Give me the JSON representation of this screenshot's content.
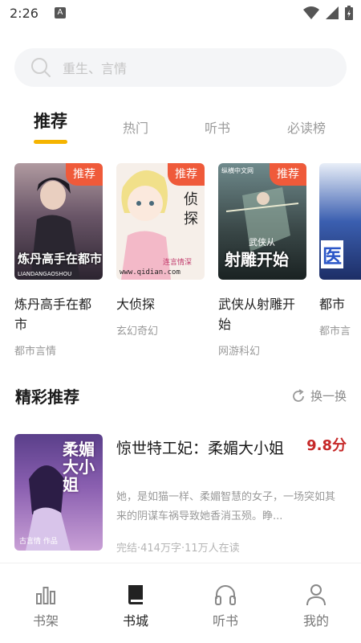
{
  "status_bar": {
    "time": "2:26",
    "notif_letter": "A"
  },
  "search": {
    "placeholder": "重生、言情"
  },
  "tabs": [
    {
      "label": "推荐"
    },
    {
      "label": "热门"
    },
    {
      "label": "听书"
    },
    {
      "label": "必读榜"
    }
  ],
  "books": [
    {
      "badge": "推荐",
      "title": "炼丹高手在都市",
      "genre": "都市言情",
      "cover_text": "炼丹高手在都市",
      "cover_sub": "LIANDANGAOSHOU"
    },
    {
      "badge": "推荐",
      "title": "大侦探",
      "genre": "玄幻奇幻",
      "cover_text": "侦探",
      "cover_sub": "www.qidian.com",
      "cover_small": "连言情深"
    },
    {
      "badge": "推荐",
      "title": "武侠从射雕开始",
      "genre": "网游科幻",
      "cover_text": "射雕开始",
      "cover_top": "武侠从",
      "cover_brand": "纵横中文网"
    },
    {
      "badge": "",
      "title": "都市",
      "genre": "都市言",
      "cover_text": "医"
    }
  ],
  "section": {
    "title": "精彩推荐",
    "refresh_label": "换一换"
  },
  "featured": {
    "title": "惊世特工妃：柔媚大小姐",
    "score": "9.8分",
    "description": "她，是如猫一样、柔媚智慧的女子，一场突如其来的阴谋车祸导致她香消玉殒。睁...",
    "stats": "完结·414万字·11万人在读",
    "cover_text": "柔媚大小姐",
    "cover_author": "古言情 作品"
  },
  "bottom_nav": [
    {
      "label": "书架",
      "icon": "bar-chart-icon"
    },
    {
      "label": "书城",
      "icon": "book-icon"
    },
    {
      "label": "听书",
      "icon": "headphones-icon"
    },
    {
      "label": "我的",
      "icon": "person-icon"
    }
  ],
  "colors": {
    "accent": "#f5b400",
    "badge": "#ef5a3a",
    "score": "#c62828"
  }
}
